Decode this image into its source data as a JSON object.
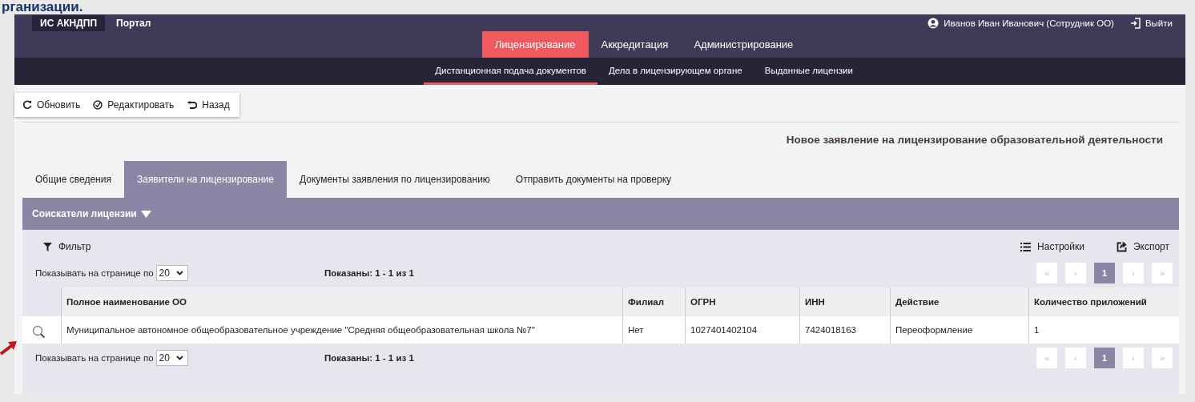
{
  "slide_caption": "рганизации.",
  "header": {
    "logo": "ИС АКНДПП",
    "portal": "Портал",
    "user": "Иванов Иван Иванович (Сотрудник ОО)",
    "logout": "Выйти"
  },
  "main_nav": [
    {
      "label": "Лицензирование",
      "selected": true
    },
    {
      "label": "Аккредитация",
      "selected": false
    },
    {
      "label": "Администрирование",
      "selected": false
    }
  ],
  "sub_nav": [
    {
      "label": "Дистанционная подача документов",
      "selected": true
    },
    {
      "label": "Дела в лицензирующем органе",
      "selected": false
    },
    {
      "label": "Выданные лицензии",
      "selected": false
    }
  ],
  "toolbar": [
    {
      "kind": "refresh",
      "label": "Обновить"
    },
    {
      "kind": "edit",
      "label": "Редактировать"
    },
    {
      "kind": "back",
      "label": "Назад"
    }
  ],
  "page_title": "Новое заявление на лицензирование образовательной деятельности",
  "tabs": [
    {
      "label": "Общие сведения",
      "selected": false
    },
    {
      "label": "Заявители на лицензирование",
      "selected": true
    },
    {
      "label": "Документы заявления по лицензированию",
      "selected": false
    },
    {
      "label": "Отправить документы на проверку",
      "selected": false
    }
  ],
  "section": {
    "label": "Соискатели лицензии",
    "expanded": true
  },
  "filter": "Фильтр",
  "settings": "Настройки",
  "export": "Экспорт",
  "pager_top": {
    "per_page_label": "Показывать на странице по",
    "per_page": "20",
    "shown": "Показаны: 1 - 1 из 1",
    "pages": [
      {
        "label": "«",
        "selected": false
      },
      {
        "label": "‹",
        "selected": false
      },
      {
        "label": "1",
        "selected": true
      },
      {
        "label": "›",
        "selected": false
      },
      {
        "label": "»",
        "selected": false
      }
    ]
  },
  "table": {
    "columns": [
      "Полное наименование ОО",
      "Филиал",
      "ОГРН",
      "ИНН",
      "Действие",
      "Количество приложений"
    ],
    "rows": [
      {
        "cells": [
          "Муниципальное автономное общеобразовательное учреждение \"Средняя общеобразовательная школа №7\"",
          "Нет",
          "1027401402104",
          "7424018163",
          "Переоформление",
          "1"
        ]
      }
    ]
  },
  "pager_bottom": {
    "per_page_label": "Показывать на странице по",
    "per_page": "20",
    "shown": "Показаны: 1 - 1 из 1",
    "pages": [
      {
        "label": "«",
        "selected": false
      },
      {
        "label": "‹",
        "selected": false
      },
      {
        "label": "1",
        "selected": true
      },
      {
        "label": "›",
        "selected": false
      },
      {
        "label": "»",
        "selected": false
      }
    ]
  }
}
